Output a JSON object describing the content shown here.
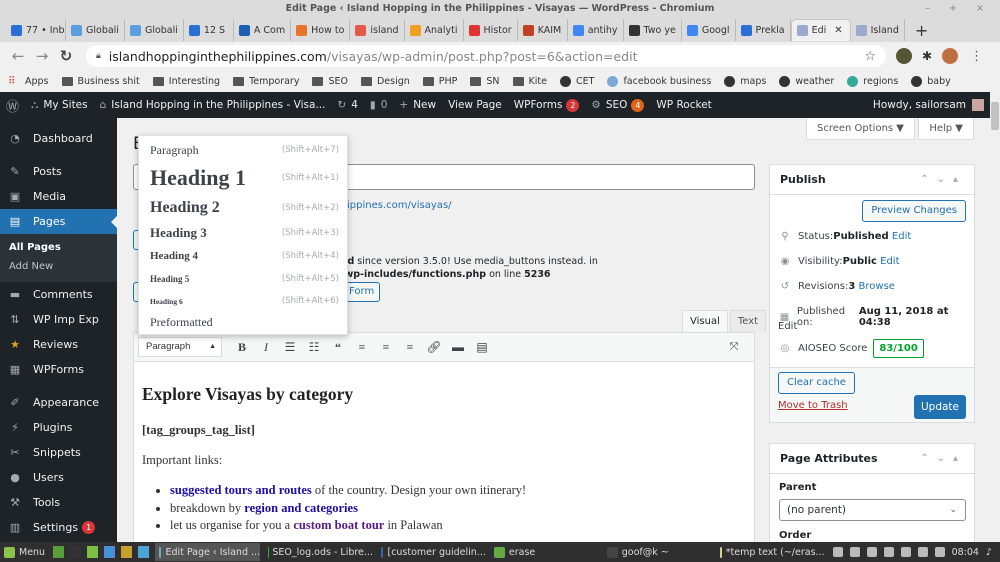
{
  "window": {
    "title": "Edit Page ‹ Island Hopping in the Philippines - Visayas — WordPress - Chromium",
    "controls": "– + ×"
  },
  "tabs": [
    {
      "label": "77 • Inb",
      "color": "#2a6fd6"
    },
    {
      "label": "Globali",
      "color": "#5aa0e0"
    },
    {
      "label": "Globali",
      "color": "#5aa0e0"
    },
    {
      "label": "12 S",
      "color": "#2a6fd6"
    },
    {
      "label": "A Com",
      "color": "#1a5fb4"
    },
    {
      "label": "How to",
      "color": "#e8742a"
    },
    {
      "label": "island",
      "color": "#e35a4a"
    },
    {
      "label": "Analyti",
      "color": "#f0a020"
    },
    {
      "label": "Histor",
      "color": "#d33"
    },
    {
      "label": "KAIM",
      "color": "#c04020"
    },
    {
      "label": "antihy",
      "color": "#4285f4"
    },
    {
      "label": "Two ye",
      "color": "#333"
    },
    {
      "label": "Googl",
      "color": "#4285f4"
    },
    {
      "label": "Prekla",
      "color": "#2a6fd6"
    },
    {
      "label": "Edi",
      "color": "#9ac",
      "active": true
    },
    {
      "label": "Island",
      "color": "#9ac"
    }
  ],
  "url": {
    "host": "islandhoppinginthephilippines.com",
    "path": "/visayas/wp-admin/post.php?post=6&action=edit"
  },
  "bookmarks": [
    {
      "label": "Apps",
      "icon": "apps-grid-icon"
    },
    {
      "label": "Business shit",
      "icon": "folder-icon"
    },
    {
      "label": "Interesting",
      "icon": "folder-icon"
    },
    {
      "label": "Temporary",
      "icon": "folder-icon"
    },
    {
      "label": "SEO",
      "icon": "folder-icon"
    },
    {
      "label": "Design",
      "icon": "folder-icon"
    },
    {
      "label": "PHP",
      "icon": "folder-icon"
    },
    {
      "label": "SN",
      "icon": "folder-icon"
    },
    {
      "label": "Kite",
      "icon": "folder-icon"
    },
    {
      "label": "CET",
      "icon": "globe-icon"
    },
    {
      "label": "facebook business",
      "icon": "facebook-icon"
    },
    {
      "label": "maps",
      "icon": "globe-icon"
    },
    {
      "label": "weather",
      "icon": "globe-icon"
    },
    {
      "label": "regions",
      "icon": "regions-icon"
    },
    {
      "label": "baby",
      "icon": "globe-icon"
    }
  ],
  "adminbar": {
    "my_sites": "My Sites",
    "site_name": "Island Hopping in the Philippines - Visa...",
    "updates": "4",
    "comments": "0",
    "new": "New",
    "view_page": "View Page",
    "wpforms": "WPForms",
    "wpforms_badge": "2",
    "seo": "SEO",
    "seo_badge": "4",
    "wp_rocket": "WP Rocket",
    "howdy": "Howdy, sailorsam"
  },
  "sidebar": {
    "items": [
      {
        "label": "Dashboard",
        "icon": "dashboard-icon",
        "glyph": "◔"
      },
      {
        "label": "Posts",
        "icon": "pin-icon",
        "glyph": "✎"
      },
      {
        "label": "Media",
        "icon": "media-icon",
        "glyph": "▣"
      },
      {
        "label": "Pages",
        "icon": "pages-icon",
        "glyph": "▤"
      },
      {
        "label": "Comments",
        "icon": "comments-icon",
        "glyph": "▬"
      },
      {
        "label": "WP Imp Exp",
        "icon": "imp-exp-icon",
        "glyph": "⇅"
      },
      {
        "label": "Reviews",
        "icon": "star-icon",
        "glyph": "★"
      },
      {
        "label": "WPForms",
        "icon": "forms-icon",
        "glyph": "▦"
      },
      {
        "label": "Appearance",
        "icon": "brush-icon",
        "glyph": "✐"
      },
      {
        "label": "Plugins",
        "icon": "plugin-icon",
        "glyph": "⚡"
      },
      {
        "label": "Snippets",
        "icon": "scissors-icon",
        "glyph": "✂"
      },
      {
        "label": "Users",
        "icon": "user-icon",
        "glyph": "●"
      },
      {
        "label": "Tools",
        "icon": "wrench-icon",
        "glyph": "⚒"
      },
      {
        "label": "Settings",
        "icon": "settings-icon",
        "glyph": "▥",
        "badge": "1"
      }
    ],
    "submenu": [
      "All Pages",
      "Add New"
    ]
  },
  "header": {
    "screen_options": "Screen Options ▼",
    "help": "Help ▼",
    "page_heading": "E"
  },
  "permalink": "ippines.com/visayas/",
  "notice": {
    "line1_bold": "ed",
    "line1_rest": " since version 3.5.0! Use media_buttons instead. in",
    "line2_bold": "/wp-includes/functions.php",
    "line2_mid": " on line ",
    "line2_num": "5236"
  },
  "form_button": "Form",
  "format_menu": {
    "items": [
      {
        "label": "Paragraph",
        "shortcut": "(Shift+Alt+7)"
      },
      {
        "label": "Heading 1",
        "shortcut": "(Shift+Alt+1)"
      },
      {
        "label": "Heading 2",
        "shortcut": "(Shift+Alt+2)"
      },
      {
        "label": "Heading 3",
        "shortcut": "(Shift+Alt+3)"
      },
      {
        "label": "Heading 4",
        "shortcut": "(Shift+Alt+4)"
      },
      {
        "label": "Heading 5",
        "shortcut": "(Shift+Alt+5)"
      },
      {
        "label": "Heading 6",
        "shortcut": "(Shift+Alt+6)"
      },
      {
        "label": "Preformatted",
        "shortcut": ""
      }
    ]
  },
  "editor": {
    "tabs": [
      "Visual",
      "Text"
    ],
    "format_value": "Paragraph",
    "heading": "Explore Visayas by category",
    "shortcode": "[tag_groups_tag_list]",
    "intro": "Important links:",
    "list": [
      {
        "link": "suggested tours and routes",
        "after": " of the country. Design your own itinerary!",
        "before": ""
      },
      {
        "before": "breakdown by ",
        "link": "region and categories",
        "after": ""
      },
      {
        "before": "let us organise for you a ",
        "link": "custom boat tour",
        "after": " in Palawan"
      }
    ]
  },
  "publish": {
    "title": "Publish",
    "preview": "Preview Changes",
    "status_label": "Status: ",
    "status_value": "Published",
    "status_edit": "Edit",
    "visibility_label": "Visibility: ",
    "visibility_value": "Public",
    "visibility_edit": "Edit",
    "revisions_label": "Revisions: ",
    "revisions_value": "3",
    "revisions_link": "Browse",
    "published_label": "Published on: ",
    "published_value": "Aug 11, 2018 at 04:38",
    "published_edit": "Edit",
    "aioseo_label": "AIOSEO Score",
    "aioseo_score": "83/100",
    "clear_cache": "Clear cache",
    "trash": "Move to Trash",
    "update": "Update"
  },
  "page_attributes": {
    "title": "Page Attributes",
    "parent_label": "Parent",
    "parent_value": "(no parent)",
    "order_label": "Order"
  },
  "taskbar": {
    "menu": "Menu",
    "windows": [
      {
        "label": "Edit Page ‹ Island ...",
        "active": true
      },
      {
        "label": "SEO_log.ods - Libre..."
      },
      {
        "label": "[customer guidelin..."
      },
      {
        "label": "erase"
      },
      {
        "label": "goof@k ~"
      },
      {
        "label": "*temp text (~/eras..."
      }
    ],
    "clock": "08:04"
  }
}
